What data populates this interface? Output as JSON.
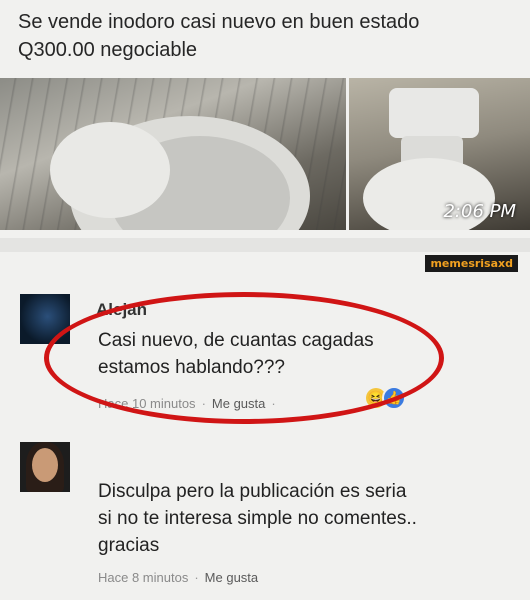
{
  "post": {
    "line1": "Se vende inodoro casi nuevo en buen estado",
    "line2": "Q300.00 negociable",
    "timestamp": "2:06 PM"
  },
  "watermark": "memesrisaxd",
  "comments": [
    {
      "author": "Alejan",
      "text1": "Casi nuevo, de cuantas cagadas",
      "text2": "estamos hablando???",
      "time": "Hace 10 minutos",
      "like": "Me gusta",
      "reactions": [
        "haha",
        "like"
      ]
    },
    {
      "author": "",
      "text1": "Disculpa pero la publicación es seria",
      "text2": "si no te interesa simple no comentes..",
      "text3": "gracias",
      "time": "Hace 8 minutos",
      "like": "Me gusta"
    }
  ],
  "colors": {
    "highlight": "#d01515",
    "watermark_text": "#f0a020"
  }
}
